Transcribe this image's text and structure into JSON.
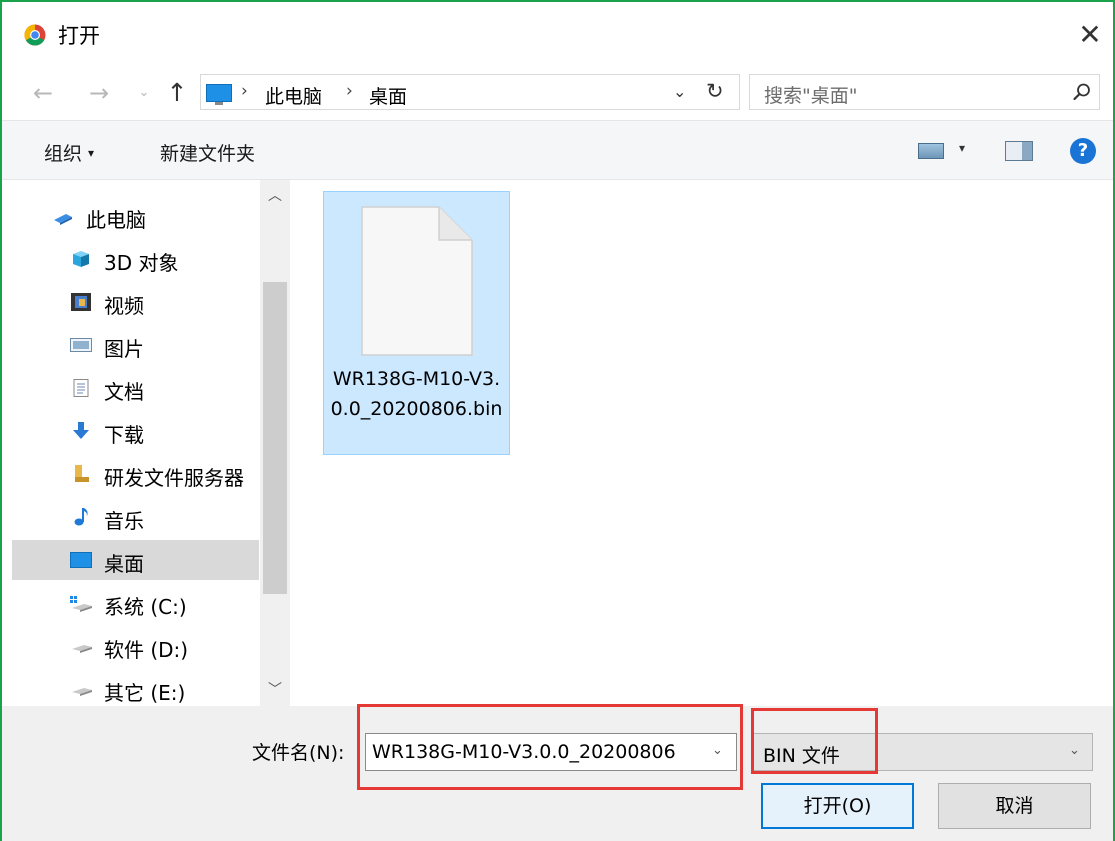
{
  "window": {
    "title": "打开",
    "close_glyph": "✕"
  },
  "nav": {
    "back_glyph": "←",
    "forward_glyph": "→",
    "recent_glyph": "⌄",
    "up_glyph": "↑"
  },
  "address": {
    "icon": "desktop-icon",
    "separator": "›",
    "crumbs": [
      "此电脑",
      "桌面"
    ],
    "dropdown_glyph": "⌄",
    "refresh_glyph": "↻"
  },
  "search": {
    "placeholder": "搜索\"桌面\"",
    "icon": "search-icon"
  },
  "command_bar": {
    "organize": "组织",
    "organize_caret": "▾",
    "new_folder": "新建文件夹",
    "view_caret": "▾",
    "help": "?"
  },
  "nav_pane": {
    "items": [
      {
        "label": "此电脑",
        "icon": "this-pc-icon"
      },
      {
        "label": "3D 对象",
        "icon": "3d-objects-icon"
      },
      {
        "label": "视频",
        "icon": "videos-icon"
      },
      {
        "label": "图片",
        "icon": "pictures-icon"
      },
      {
        "label": "文档",
        "icon": "documents-icon"
      },
      {
        "label": "下载",
        "icon": "downloads-icon"
      },
      {
        "label": "研发文件服务器",
        "icon": "network-folder-icon"
      },
      {
        "label": "音乐",
        "icon": "music-icon"
      },
      {
        "label": "桌面",
        "icon": "desktop-icon",
        "selected": true
      },
      {
        "label": "系统 (C:)",
        "icon": "system-drive-icon"
      },
      {
        "label": "软件 (D:)",
        "icon": "drive-icon"
      },
      {
        "label": "其它 (E:)",
        "icon": "drive-icon"
      }
    ],
    "scroll_up_glyph": "︿",
    "scroll_down_glyph": "﹀"
  },
  "files": [
    {
      "name": "WR138G-M10-V3.0.0_20200806.bin",
      "icon": "file-icon",
      "selected": true
    }
  ],
  "footer": {
    "filename_label": "文件名(N):",
    "filename_value": "WR138G-M10-V3.0.0_20200806",
    "filename_arrow": "⌄",
    "filetype_value": "BIN 文件",
    "filetype_arrow": "⌄",
    "open_button": "打开(O)",
    "cancel_button": "取消"
  },
  "colors": {
    "window_border": "#1aa34a",
    "highlight": "#e53935",
    "selection": "#cce8ff",
    "accent": "#0078d7"
  }
}
